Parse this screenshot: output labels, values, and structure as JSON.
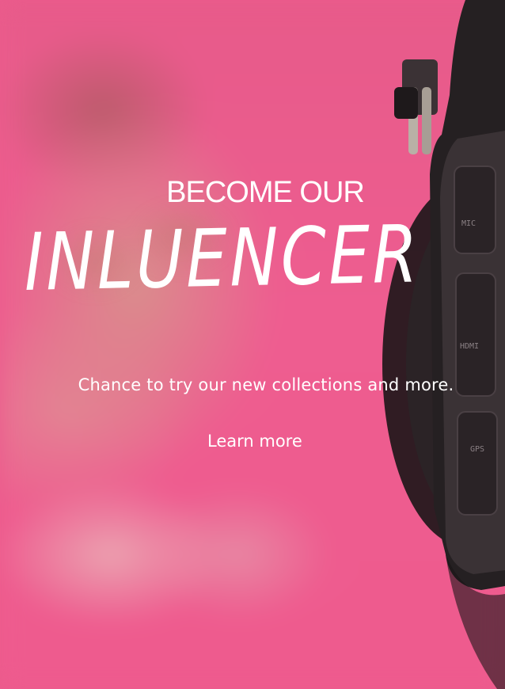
{
  "hero": {
    "eyebrow": "BECOME OUR",
    "headline": "INLUENCER",
    "subtitle": "Chance to try our new collections and more.",
    "cta_label": "Learn more",
    "background_color": "#ec5b8c",
    "text_color": "#ffffff",
    "image": "camera-icon"
  }
}
